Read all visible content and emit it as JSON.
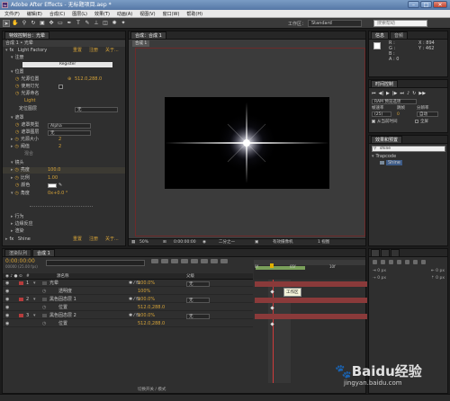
{
  "window": {
    "title": "Adobe After Effects - 无标题项目.aep *",
    "minimize": "–",
    "maximize": "□",
    "close": "✕"
  },
  "menu": [
    "文件(F)",
    "编辑(E)",
    "合成(C)",
    "图层(L)",
    "效果(T)",
    "动画(A)",
    "视图(V)",
    "窗口(W)",
    "帮助(H)"
  ],
  "toolbar": {
    "workspace_label": "工作区：",
    "workspace_value": "Standard",
    "search_placeholder": "搜索帮助"
  },
  "effect_controls": {
    "tab": "特效控制台：光晕",
    "breadcrumb": "合成 1 • 光晕",
    "effect_name": "Light Factory",
    "reset": "重置",
    "register": "注册",
    "about": "关于...",
    "section_register": "注册",
    "register_button": "Register",
    "section_location": "位置",
    "light_source_location_label": "光源位置",
    "light_source_location_value": "512.0,288.0",
    "use_light_label": "使用灯光",
    "use_light_value": "",
    "light_source_name_label": "光源命名",
    "light_source_name_value": "Light",
    "location_layer_label": "定位图层",
    "location_layer_value": "无",
    "section_obscuration": "遮罩",
    "obscuration_type_label": "遮罩类型",
    "obscuration_type_value": "Alpha",
    "obscuration_layer_label": "遮罩图层",
    "obscuration_layer_value": "无",
    "source_size_label": "光源大小",
    "source_size_value": "2",
    "threshold_label": "阈值",
    "threshold_value": "2",
    "blend_label": "混合",
    "section_lens": "镜头",
    "brightness_label": "亮度",
    "brightness_value": "100.0",
    "scale_label": "比例",
    "scale_value": "1.00",
    "color_label": "颜色",
    "angle_label": "角度",
    "angle_value": "0x+0.0 °",
    "section_behavior": "行为",
    "section_edge_reaction": "边缘反应",
    "section_render": "渲染",
    "shine_name": "Shine",
    "shine_reset": "重置",
    "shine_register": "注册",
    "shine_about": "关于..."
  },
  "composition": {
    "tab": "合成：合成 1",
    "sub_tab": "合成 1",
    "zoom": "50%",
    "timecode": "0:00:00:00",
    "quality": "二分之一",
    "view": "有效摄像机",
    "views": "1 视图"
  },
  "info": {
    "tab1": "信息",
    "tab2": "音频",
    "r_label": "R :",
    "g_label": "G :",
    "b_label": "B :",
    "a_label": "A :",
    "r_val": "",
    "g_val": "",
    "b_val": "",
    "a_val": "0",
    "x_label": "X : 894",
    "y_label": "Y : 462"
  },
  "preview": {
    "tab": "时间控制",
    "ram_label": "RAM 预览选项",
    "frame_rate_label": "帧速率",
    "skip_label": "跳帧",
    "resolution_label": "分辨率",
    "frame_rate_value": "(25)",
    "skip_value": "0",
    "resolution_value": "自动",
    "from_current": "从当前时间",
    "full_screen": "全屏"
  },
  "effects_presets": {
    "tab": "效果和预置",
    "search_value": "shine",
    "group": "Trapcode",
    "item": "Shine"
  },
  "timeline": {
    "tab_render": "渲染队列",
    "tab_comp": "合成 1",
    "timecode": "0:00:00:00",
    "frames": "00000 (25.00 fps)",
    "col_source": "源名称",
    "col_parent": "父级",
    "tooltip": "工作区",
    "ruler": [
      "0f",
      "05f",
      "10f"
    ],
    "toggle_label": "切换开关 / 模式",
    "layers": [
      {
        "num": "1",
        "name": "光晕",
        "parent": "无",
        "prop": "100.0%",
        "color": "#b73c3c",
        "expanded": true
      },
      {
        "num": "",
        "name": "透明度",
        "parent": "",
        "prop": "100%",
        "color": "",
        "expanded": false
      },
      {
        "num": "2",
        "name": "黑色固态层 1",
        "parent": "无",
        "prop": "100.0%",
        "color": "#b73c3c",
        "expanded": true
      },
      {
        "num": "",
        "name": "位置",
        "parent": "",
        "prop": "512.0,288.0",
        "color": "",
        "expanded": false
      },
      {
        "num": "3",
        "name": "黑色固态层 2",
        "parent": "无",
        "prop": "100.0%",
        "color": "#b73c3c",
        "expanded": true
      },
      {
        "num": "",
        "name": "位置",
        "parent": "",
        "prop": "512.0,288.0",
        "color": "",
        "expanded": false
      }
    ]
  },
  "watermark": {
    "brand": "Baidu经验",
    "url": "jingyan.baidu.com"
  }
}
